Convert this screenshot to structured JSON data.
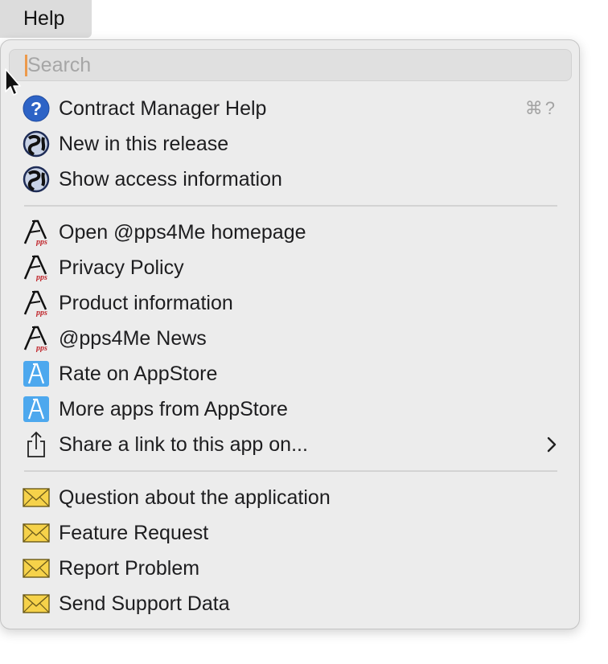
{
  "menubar": {
    "title": "Help"
  },
  "search": {
    "placeholder": "Search",
    "value": ""
  },
  "groups": [
    {
      "items": [
        {
          "label": "Contract Manager Help",
          "icon": "help-question-icon",
          "shortcut": "⌘?"
        },
        {
          "label": "New in this release",
          "icon": "globe-icon"
        },
        {
          "label": "Show access information",
          "icon": "globe-icon"
        }
      ]
    },
    {
      "items": [
        {
          "label": "Open @pps4Me homepage",
          "icon": "apps4me-logo-icon"
        },
        {
          "label": "Privacy Policy",
          "icon": "apps4me-logo-icon"
        },
        {
          "label": "Product information",
          "icon": "apps4me-logo-icon"
        },
        {
          "label": "@pps4Me News",
          "icon": "apps4me-logo-icon"
        },
        {
          "label": "Rate on AppStore",
          "icon": "appstore-icon"
        },
        {
          "label": "More apps from AppStore",
          "icon": "appstore-icon"
        },
        {
          "label": "Share a link to this app on...",
          "icon": "share-icon",
          "submenu": true
        }
      ]
    },
    {
      "items": [
        {
          "label": "Question about the application",
          "icon": "envelope-icon"
        },
        {
          "label": "Feature Request",
          "icon": "envelope-icon"
        },
        {
          "label": "Report Problem",
          "icon": "envelope-icon"
        },
        {
          "label": "Send Support Data",
          "icon": "envelope-icon"
        }
      ]
    }
  ],
  "colors": {
    "menu_background": "#ececec",
    "help_icon_blue": "#2d63c6",
    "appstore_blue": "#4da8ee",
    "envelope_yellow": "#f6d24a",
    "caret_orange": "#ec9a4c"
  }
}
